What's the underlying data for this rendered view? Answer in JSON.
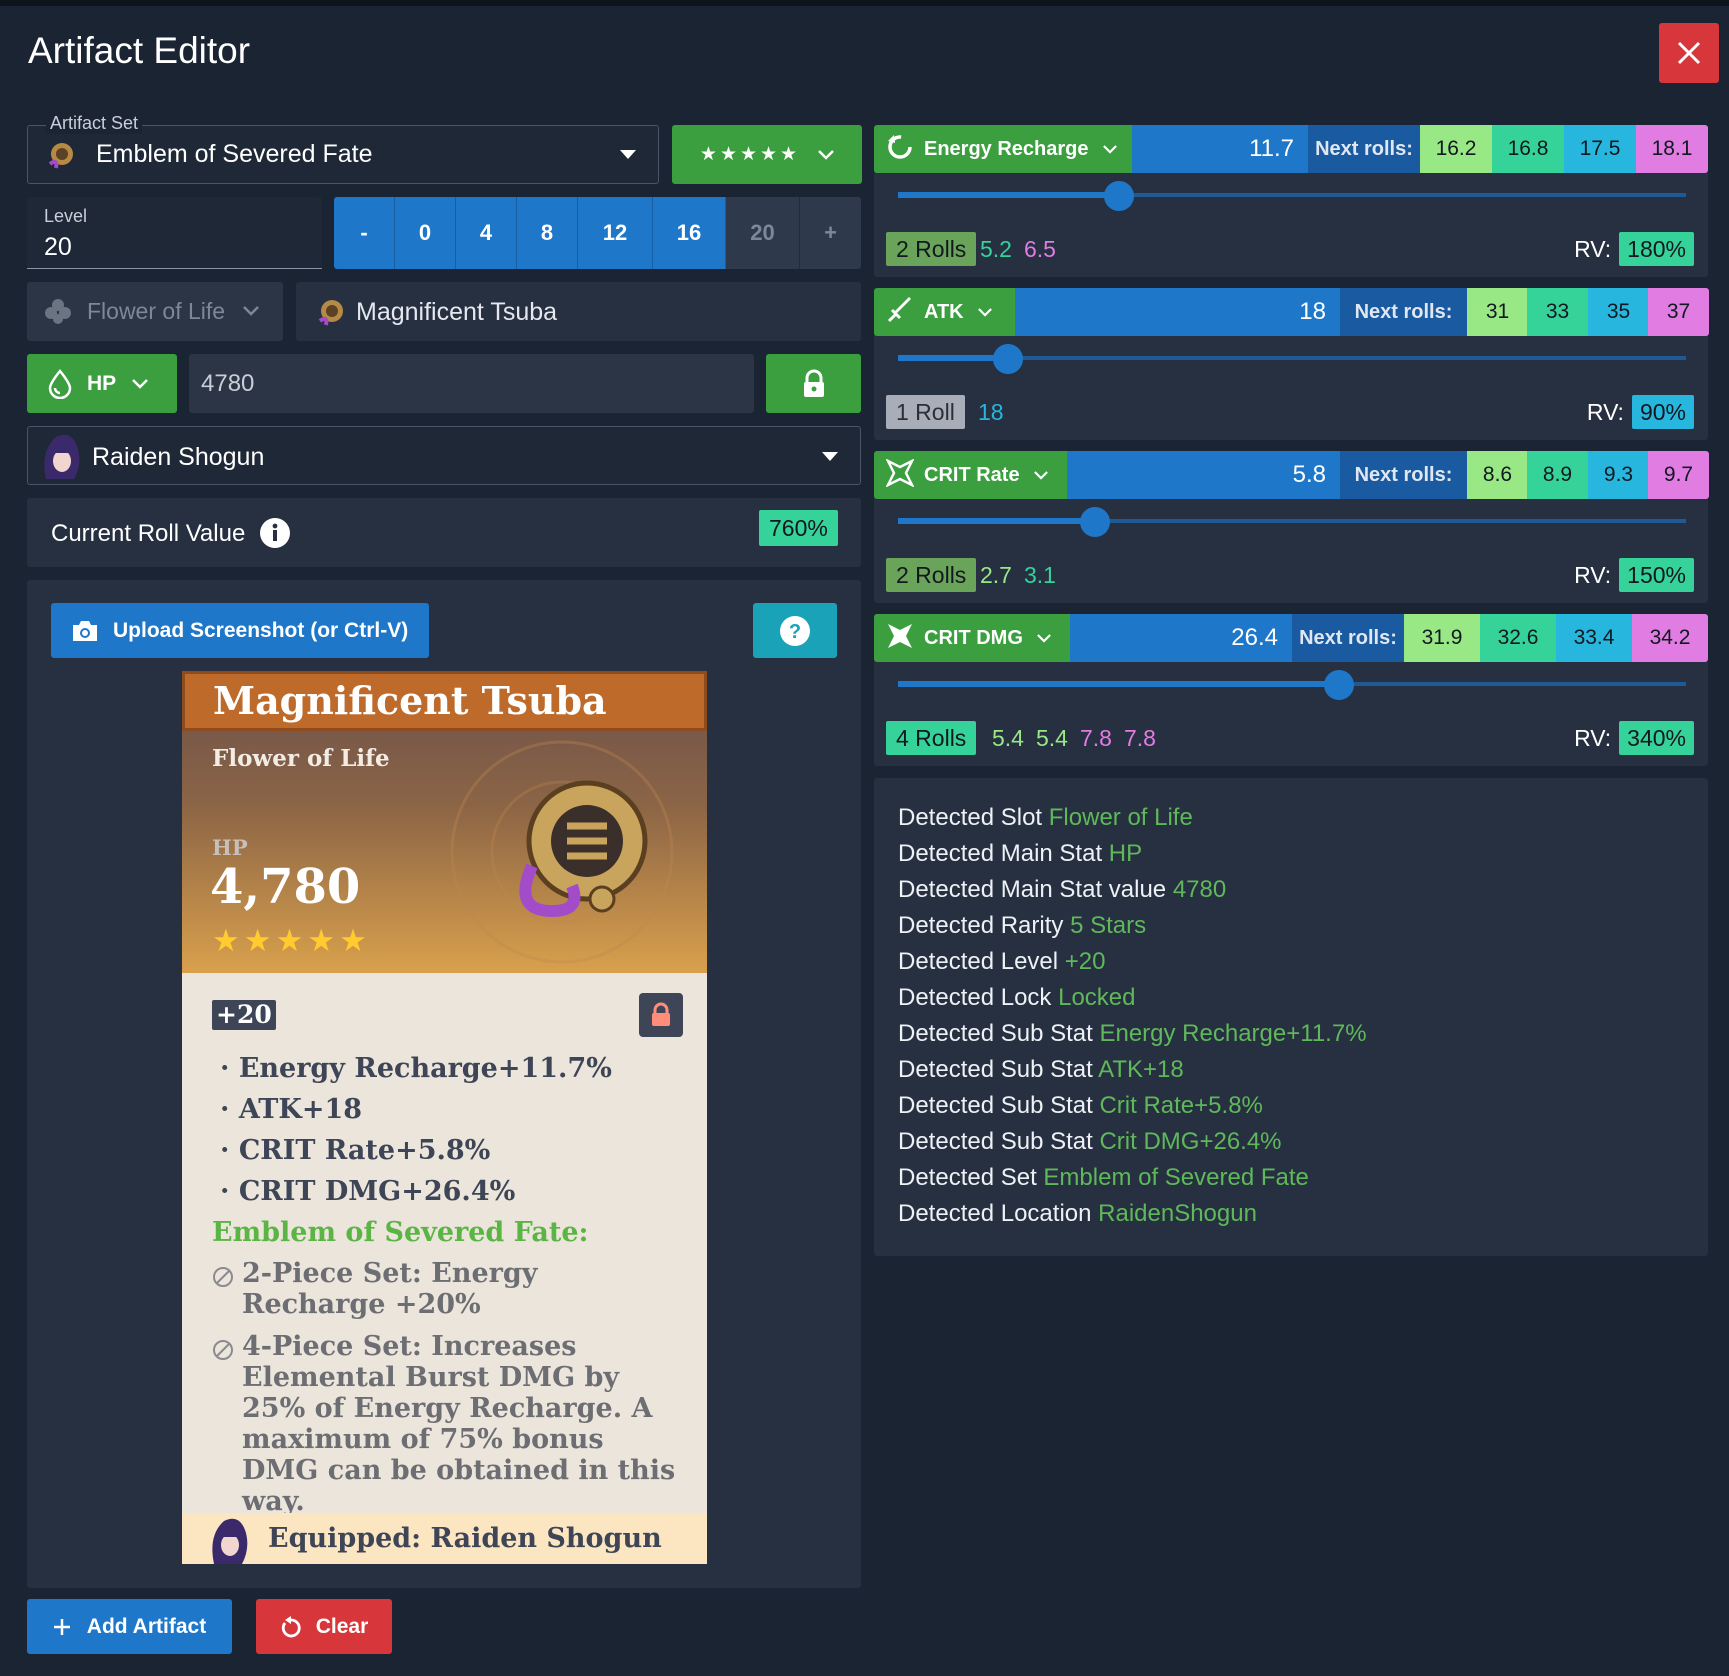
{
  "window": {
    "title": "Artifact Editor",
    "close_icon": "close-icon"
  },
  "artifact_set": {
    "label": "Artifact Set",
    "value": "Emblem of Severed Fate"
  },
  "rarity": {
    "stars": 5,
    "star_text": "★★★★★"
  },
  "level": {
    "label": "Level",
    "value": "20",
    "buttons": [
      "-",
      "0",
      "4",
      "8",
      "12",
      "16",
      "20",
      "+"
    ],
    "disabled": "20"
  },
  "slot": {
    "value": "Flower of Life",
    "piece_name": "Magnificent Tsuba"
  },
  "main_stat": {
    "key": "HP",
    "value": "4780"
  },
  "character": {
    "value": "Raiden Shogun"
  },
  "roll_value": {
    "label": "Current Roll Value",
    "value": "760%"
  },
  "upload": {
    "label": "Upload Screenshot (or Ctrl-V)",
    "help": "?"
  },
  "card": {
    "name": "Magnificent Tsuba",
    "slot": "Flower of Life",
    "main_stat": "HP",
    "main_value": "4,780",
    "level": "+20",
    "substats": [
      "Energy Recharge+11.7%",
      "ATK+18",
      "CRIT Rate+5.8%",
      "CRIT DMG+26.4%"
    ],
    "set_title": "Emblem of Severed Fate:",
    "set_2pc": "2-Piece Set: Energy Recharge +20%",
    "set_4pc": "4-Piece Set: Increases Elemental Burst DMG by 25% of Energy Recharge. A maximum of 75% bonus DMG can be obtained in this way.",
    "equipped": "Equipped: Raiden Shogun"
  },
  "substats": [
    {
      "name": "Energy Recharge",
      "icon": "energy-recharge-icon",
      "value": "11.7",
      "next_label": "Next rolls:",
      "next": [
        "16.2",
        "16.8",
        "17.5",
        "18.1"
      ],
      "slider": 0.28,
      "rolls_label": "2 Rolls",
      "rolls": [
        "5.2",
        "6.5"
      ],
      "rv_label": "RV:",
      "rv": "180%"
    },
    {
      "name": "ATK",
      "icon": "sword-icon",
      "value": "18",
      "next_label": "Next rolls:",
      "next": [
        "31",
        "33",
        "35",
        "37"
      ],
      "slider": 0.14,
      "rolls_label": "1 Roll",
      "rolls": [
        "18"
      ],
      "rv_label": "RV:",
      "rv": "90%"
    },
    {
      "name": "CRIT Rate",
      "icon": "crit-rate-icon",
      "value": "5.8",
      "next_label": "Next rolls:",
      "next": [
        "8.6",
        "8.9",
        "9.3",
        "9.7"
      ],
      "slider": 0.25,
      "rolls_label": "2 Rolls",
      "rolls": [
        "2.7",
        "3.1"
      ],
      "rv_label": "RV:",
      "rv": "150%"
    },
    {
      "name": "CRIT DMG",
      "icon": "crit-dmg-icon",
      "value": "26.4",
      "next_label": "Next rolls:",
      "next": [
        "31.9",
        "32.6",
        "33.4",
        "34.2"
      ],
      "slider": 0.56,
      "rolls_label": "4 Rolls",
      "rolls": [
        "5.4",
        "5.4",
        "7.8",
        "7.8"
      ],
      "rv_label": "RV:",
      "rv": "340%"
    }
  ],
  "detected": [
    {
      "label": "Detected Slot",
      "value": "Flower of Life"
    },
    {
      "label": "Detected Main Stat",
      "value": "HP"
    },
    {
      "label": "Detected Main Stat value",
      "value": "4780"
    },
    {
      "label": "Detected Rarity",
      "value": "5 Stars"
    },
    {
      "label": "Detected Level",
      "value": "+20"
    },
    {
      "label": "Detected Lock",
      "value": "Locked"
    },
    {
      "label": "Detected Sub Stat",
      "value": "Energy Recharge+11.7%"
    },
    {
      "label": "Detected Sub Stat",
      "value": "ATK+18"
    },
    {
      "label": "Detected Sub Stat",
      "value": "Crit Rate+5.8%"
    },
    {
      "label": "Detected Sub Stat",
      "value": "Crit DMG+26.4%"
    },
    {
      "label": "Detected Set",
      "value": "Emblem of Severed Fate"
    },
    {
      "label": "Detected Location",
      "value": "RaidenShogun"
    }
  ],
  "footer": {
    "add_label": "Add Artifact",
    "clear_label": "Clear"
  },
  "colors": {
    "accent": "#1f77c9",
    "green": "#3b9e3f",
    "danger": "#d7363a",
    "bg": "#1b2433",
    "panel": "#263040",
    "roll1": "#98e885",
    "roll2": "#35d39a",
    "roll3": "#27b6de",
    "roll4": "#e07ce2"
  }
}
